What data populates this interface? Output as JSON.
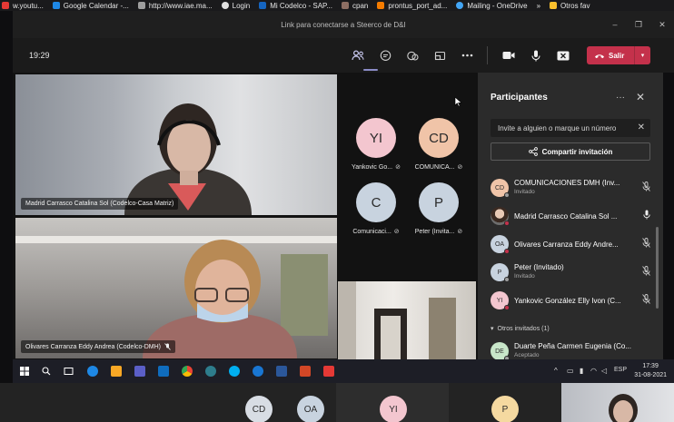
{
  "bookmarks": [
    {
      "label": "w.youtu...",
      "color": "#e53935"
    },
    {
      "label": "Google Calendar -...",
      "color": "#1e88e5"
    },
    {
      "label": "http://www.iae.ma...",
      "color": "#9e9e9e"
    },
    {
      "label": "Login",
      "color": "#e0e0e0"
    },
    {
      "label": "Mi Codelco - SAP...",
      "color": "#1565c0"
    },
    {
      "label": "cpan",
      "color": "#8d6e63"
    },
    {
      "label": "prontus_port_ad...",
      "color": "#f57c00"
    },
    {
      "label": "Mailing - OneDrive",
      "color": "#42a5f5"
    }
  ],
  "bookmarks_overflow": "»",
  "bookmarks_other": "Otros fav",
  "window": {
    "title": "Link para conectarse a Steerco de D&I",
    "minimize": "–",
    "restore": "❐",
    "close": "✕"
  },
  "toolbar": {
    "timer": "19:29",
    "leave_label": "Salir",
    "leave_color": "#c4314b"
  },
  "videos": {
    "v1_name": "Madrid Carrasco Catalina Sol (Codelco-Casa Matriz)",
    "v2_name": "Olivares Carranza Eddy Andrea (Codelco-DMH)"
  },
  "tiles": [
    {
      "initials": "YI",
      "name": "Yankovic Go...",
      "color": "#f3c6cf"
    },
    {
      "initials": "CD",
      "name": "COMUNICA...",
      "color": "#f0c4a8"
    },
    {
      "initials": "C",
      "name": "Comunicaci...",
      "color": "#c8d3df"
    },
    {
      "initials": "P",
      "name": "Peter (Invita...",
      "color": "#c8d3df"
    }
  ],
  "panel": {
    "title": "Participantes",
    "more": "···",
    "close": "✕",
    "invite_placeholder": "Invite a alguien o marque un número",
    "share_label": "Compartir invitación",
    "section_label": "Otros invitados (1)"
  },
  "participants": [
    {
      "initials": "CD",
      "name": "COMUNICACIONES DMH (Inv...",
      "sub": "Invitado",
      "color": "#f0c4a8",
      "dot": "#9e9e9e",
      "muted": true
    },
    {
      "initials": "",
      "name": "Madrid Carrasco Catalina Sol ...",
      "sub": "",
      "color": "",
      "dot": "#c4314b",
      "muted": false
    },
    {
      "initials": "OA",
      "name": "Olivares Carranza Eddy Andre...",
      "sub": "",
      "color": "#c8d3df",
      "dot": "#c4314b",
      "muted": true
    },
    {
      "initials": "P",
      "name": "Peter (Invitado)",
      "sub": "Invitado",
      "color": "#c8d3df",
      "dot": "#9e9e9e",
      "muted": true
    },
    {
      "initials": "YI",
      "name": "Yankovic González Elly Ivon (C...",
      "sub": "",
      "color": "#f3c6cf",
      "dot": "#c4314b",
      "muted": true
    }
  ],
  "other_invited": [
    {
      "initials": "DE",
      "name": "Duarte Peña Carmen Eugenia (Co...",
      "sub": "Aceptado",
      "color": "#c8e6c9",
      "dot": "#9e9e9e"
    }
  ],
  "taskbar": {
    "lang": "ESP",
    "time": "17:39",
    "date": "31-08-2021"
  },
  "strip_avatars": [
    {
      "initials": "CD",
      "color": "#d8dde4"
    },
    {
      "initials": "OA",
      "color": "#c8d3df"
    },
    {
      "initials": "YI",
      "color": "#f3c6cf"
    },
    {
      "initials": "P",
      "color": "#f5d9a0"
    }
  ]
}
